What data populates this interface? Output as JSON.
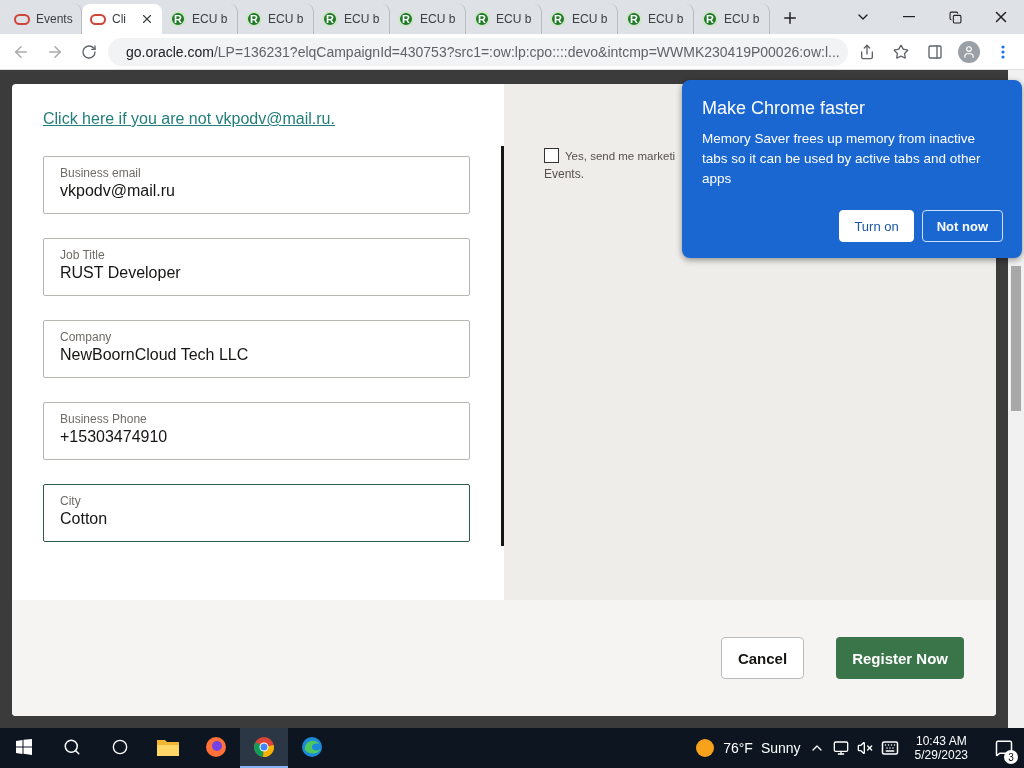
{
  "browser": {
    "tabs": [
      {
        "kind": "oracle",
        "title": "Events",
        "selected": false
      },
      {
        "kind": "oracle",
        "title": "Cli",
        "selected": true
      },
      {
        "kind": "letter",
        "letter": "R",
        "title": "ECU b",
        "selected": false
      },
      {
        "kind": "letter",
        "letter": "R",
        "title": "ECU b",
        "selected": false
      },
      {
        "kind": "letter",
        "letter": "R",
        "title": "ECU b",
        "selected": false
      },
      {
        "kind": "letter",
        "letter": "R",
        "title": "ECU b",
        "selected": false
      },
      {
        "kind": "letter",
        "letter": "R",
        "title": "ECU b",
        "selected": false
      },
      {
        "kind": "letter",
        "letter": "R",
        "title": "ECU b",
        "selected": false
      },
      {
        "kind": "letter",
        "letter": "R",
        "title": "ECU b",
        "selected": false
      },
      {
        "kind": "letter",
        "letter": "R",
        "title": "ECU b",
        "selected": false
      }
    ],
    "url_host": "go.oracle.com",
    "url_rest": "/LP=136231?elqCampaignId=430753?src1=:ow:lp:cpo::::devo&intcmp=WWMK230419P00026:ow:l..."
  },
  "modal": {
    "switch_link": "Click here if you are not vkpodv@mail.ru.",
    "fields": [
      {
        "label": "Business email",
        "value": "vkpodv@mail.ru",
        "focused": false
      },
      {
        "label": "Job Title",
        "value": "RUST Developer",
        "focused": false
      },
      {
        "label": "Company",
        "value": "NewBoornCloud Tech LLC",
        "focused": false
      },
      {
        "label": "Business Phone",
        "value": "+15303474910",
        "focused": false
      },
      {
        "label": "City",
        "value": "Cotton",
        "focused": true
      }
    ],
    "consent": {
      "checked": false,
      "text": "Yes, send me marketi",
      "text_2": "Events."
    },
    "cancel": "Cancel",
    "submit": "Register Now"
  },
  "popup": {
    "title": "Make Chrome faster",
    "body": "Memory Saver frees up memory from inactive tabs so it can be used by active tabs and other apps",
    "primary": "Turn on",
    "secondary": "Not now"
  },
  "taskbar": {
    "apps": [
      {
        "kind": "folder",
        "active": false
      },
      {
        "kind": "firefox",
        "active": false
      },
      {
        "kind": "chrome",
        "active": true
      },
      {
        "kind": "edge",
        "active": false
      }
    ],
    "temperature": "76°F",
    "weather": "Sunny",
    "time": "10:43 AM",
    "date": "5/29/2023",
    "notifications": "3"
  }
}
